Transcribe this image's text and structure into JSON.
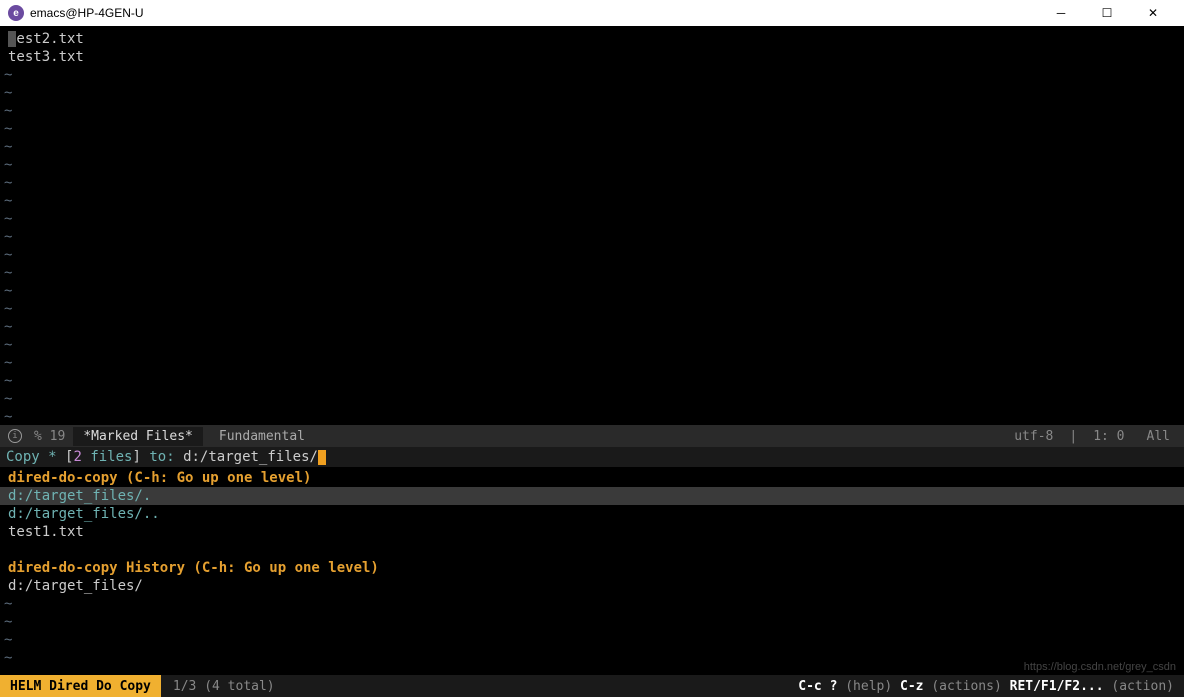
{
  "window": {
    "title": "emacs@HP-4GEN-U"
  },
  "buffer": {
    "lines": [
      "test2.txt",
      "test3.txt"
    ]
  },
  "modeline": {
    "percent": "% 19",
    "buffer_name": "*Marked Files*",
    "major_mode": "Fundamental",
    "encoding": "utf-8",
    "position": "1: 0",
    "scroll": "All"
  },
  "minibuffer": {
    "prompt_pre": "Copy * ",
    "bracket_open": "[",
    "count": "2",
    "count_suffix": " files",
    "bracket_close": "]",
    "prompt_mid": " to: ",
    "path": "d:/target_files/"
  },
  "helm": {
    "source1": "dired-do-copy (C-h: Go up one level)",
    "selected": "d:/target_files/.",
    "item1": "d:/target_files/..",
    "item2": "test1.txt",
    "source2": "dired-do-copy History (C-h: Go up one level)",
    "item3": "d:/target_files/"
  },
  "helm_modeline": {
    "title": "HELM Dired Do Copy",
    "count": "1/3 (4 total)",
    "help_key1": "C-c ?",
    "help_txt1": "(help)",
    "help_key2": "C-z",
    "help_txt2": "(actions)",
    "help_key3": "RET/F1/F2...",
    "help_txt3": "(action)"
  },
  "watermark": "https://blog.csdn.net/grey_csdn"
}
